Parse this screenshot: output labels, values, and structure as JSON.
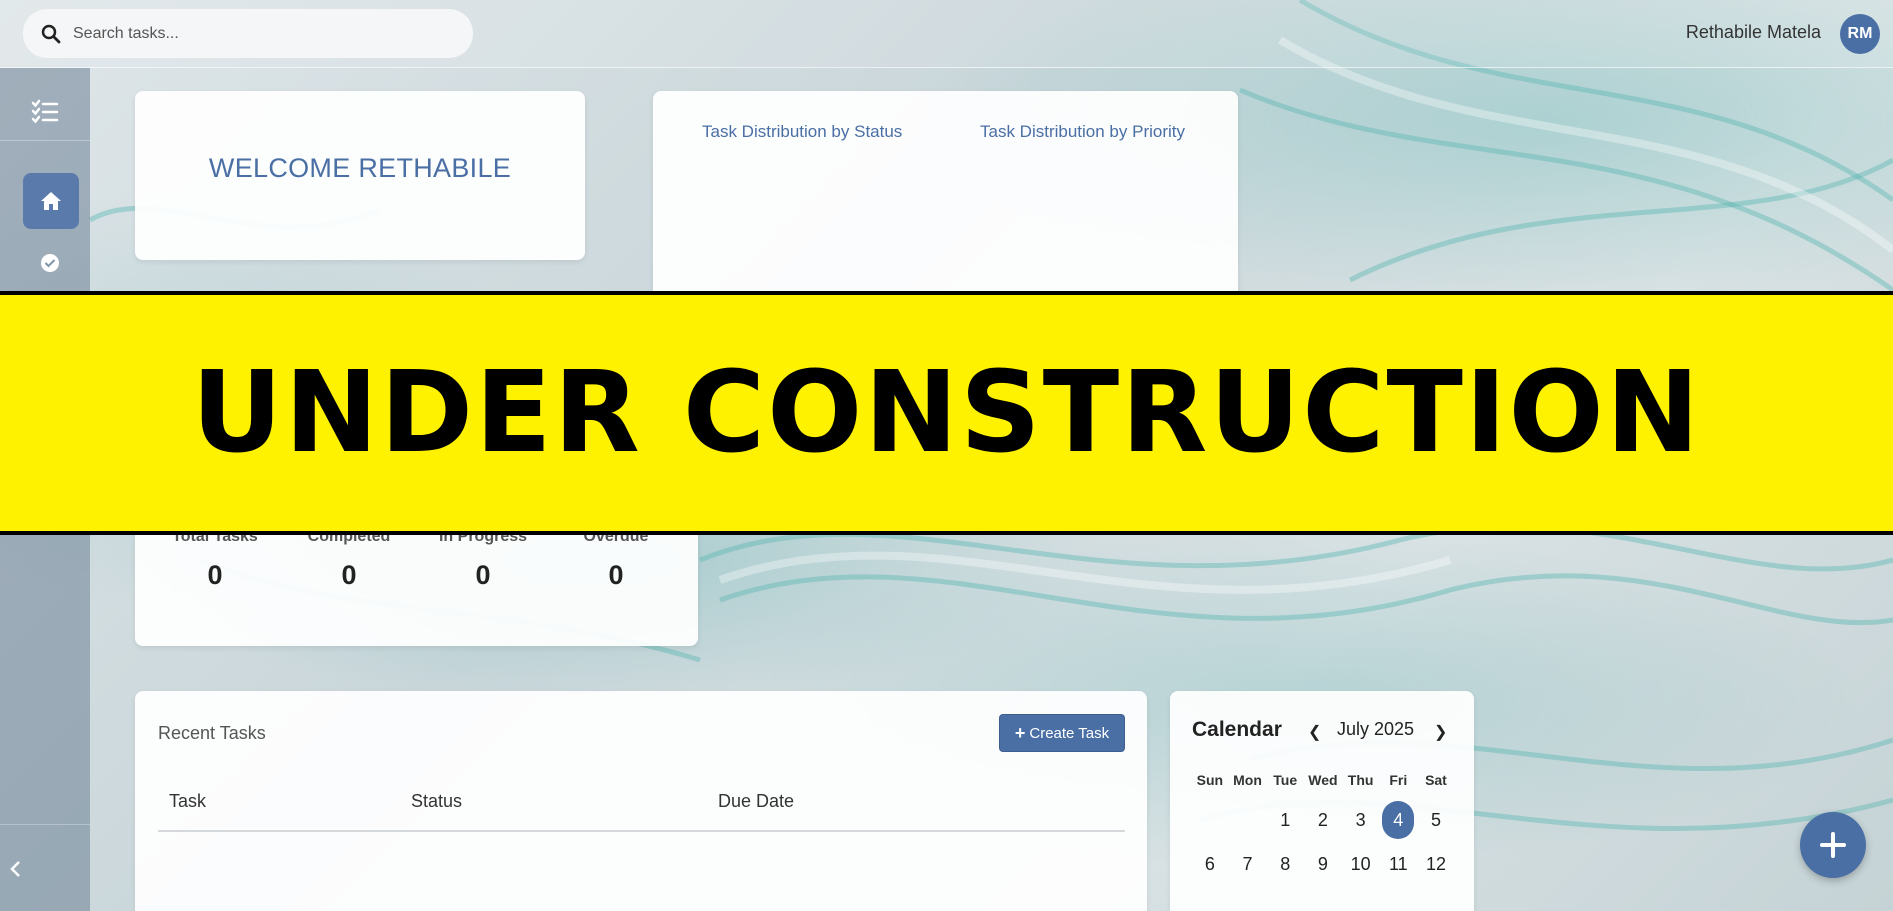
{
  "search": {
    "placeholder": "Search tasks..."
  },
  "user": {
    "name": "Rethabile Matela",
    "initials": "RM"
  },
  "sidebar": {
    "items": [
      {
        "name": "logo",
        "icon": "tasks-list-icon"
      },
      {
        "name": "home",
        "icon": "home-icon",
        "active": true
      },
      {
        "name": "tasks",
        "icon": "check-circle-icon"
      }
    ],
    "collapse_icon": "chevron-left-icon"
  },
  "welcome": {
    "title": "WELCOME RETHABILE"
  },
  "distribution": {
    "status_title": "Task Distribution by Status",
    "priority_title": "Task Distribution by Priority"
  },
  "banner": {
    "text": "UNDER CONSTRUCTION"
  },
  "stats": [
    {
      "label": "Total Tasks",
      "value": "0"
    },
    {
      "label": "Completed",
      "value": "0"
    },
    {
      "label": "In Progress",
      "value": "0"
    },
    {
      "label": "Overdue",
      "value": "0"
    }
  ],
  "recent": {
    "title": "Recent Tasks",
    "create_label": "Create Task",
    "columns": [
      "Task",
      "Status",
      "Due Date"
    ]
  },
  "calendar": {
    "title": "Calendar",
    "month": "July 2025",
    "weekdays": [
      "Sun",
      "Mon",
      "Tue",
      "Wed",
      "Thu",
      "Fri",
      "Sat"
    ],
    "week1": [
      "",
      "",
      "1",
      "2",
      "3",
      "4",
      "5"
    ],
    "week2": [
      "6",
      "7",
      "8",
      "9",
      "10",
      "11",
      "12"
    ],
    "today": "4"
  },
  "colors": {
    "accent": "#4a6fa5",
    "banner": "#fff200"
  },
  "fab": {
    "icon": "plus-icon"
  }
}
